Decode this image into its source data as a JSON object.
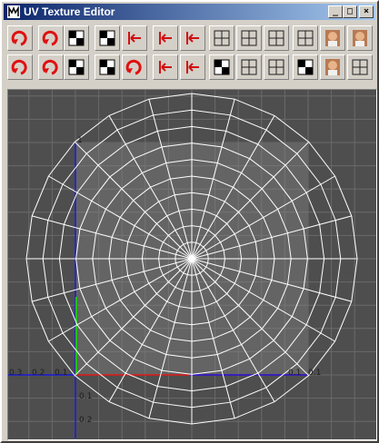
{
  "window": {
    "title": "UV Texture Editor"
  },
  "caption_buttons": {
    "minimize": "_",
    "maximize": "□",
    "close": "×"
  },
  "toolbar": {
    "row1": [
      "flip-uv-horizontal-icon",
      "flip-uv-vertical-icon",
      "rotate-uv-ccw-checker-icon",
      "rotate-uv-cw-checker-icon",
      "cycle-uvs-icon",
      "align-uvs-left-icon",
      "align-uvs-right-icon",
      "grid-uvs-icon",
      "select-uv-shell-icon",
      "add-uv-icon",
      "toggle-grid-icon",
      "display-image-icon",
      "unlock-image-icon"
    ],
    "row2": [
      "rotate-ccw-icon",
      "rotate-cw-icon",
      "move-uv-shell-icon",
      "relax-uvs-icon",
      "sew-uvs-icon",
      "align-uvs-bottom-icon",
      "align-uvs-top-icon",
      "checker-map-icon",
      "select-contained-faces-icon",
      "remove-uv-icon",
      "dim-image-icon",
      "image-range-icon",
      "pixel-snap-icon"
    ]
  },
  "viewport": {
    "colors": {
      "background": "#4e4e4e",
      "uv_square": "#646464",
      "wireframe": "#ffffff",
      "u_axis": "#e01818",
      "v_axis": "#1818e0",
      "selected_edge": "#20c020",
      "grid": "#6a6a6a"
    },
    "u_labels": [
      "0.3",
      "0.2",
      "0.1",
      "0.1"
    ],
    "u_labels_right": [
      "0.1",
      "0.1"
    ],
    "v_labels": [
      "1",
      "0.1",
      "0.2"
    ],
    "wireframe": {
      "radial_segments": 24,
      "rings": 10
    }
  }
}
